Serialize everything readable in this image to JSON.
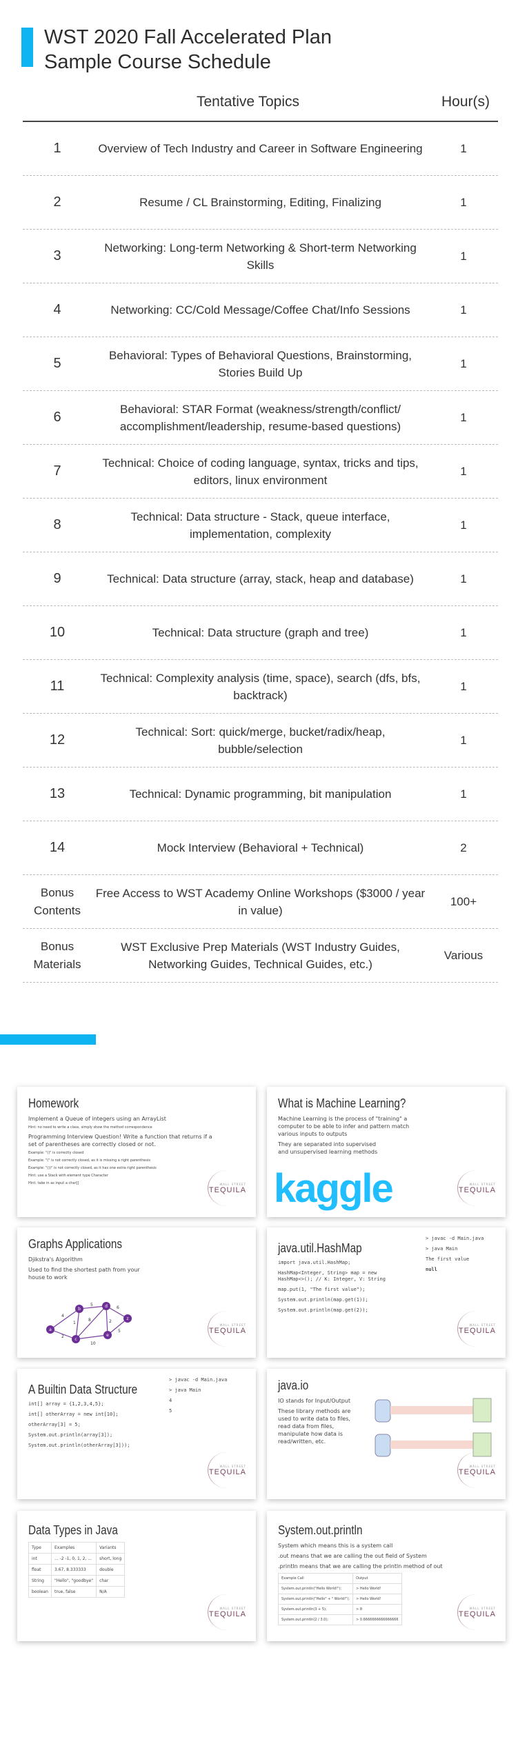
{
  "header": {
    "title_line1": "WST 2020 Fall Accelerated Plan",
    "title_line2": "Sample Course Schedule",
    "accent_color": "#0db4f0"
  },
  "table": {
    "col_topics": "Tentative Topics",
    "col_hours": "Hour(s)",
    "rows": [
      {
        "num": "1",
        "topic": "Overview of Tech Industry and Career in Software Engineering",
        "hours": "1"
      },
      {
        "num": "2",
        "topic": "Resume / CL Brainstorming, Editing, Finalizing",
        "hours": "1"
      },
      {
        "num": "3",
        "topic": "Networking: Long-term Networking & Short-term Networking Skills",
        "hours": "1"
      },
      {
        "num": "4",
        "topic": "Networking: CC/Cold Message/Coffee Chat/Info Sessions",
        "hours": "1"
      },
      {
        "num": "5",
        "topic": "Behavioral: Types of Behavioral Questions, Brainstorming, Stories Build Up",
        "hours": "1"
      },
      {
        "num": "6",
        "topic": "Behavioral: STAR Format (weakness/strength/conflict/ accomplishment/leadership, resume-based questions)",
        "hours": "1"
      },
      {
        "num": "7",
        "topic": "Technical: Choice of coding language, syntax, tricks and tips, editors, linux environment",
        "hours": "1"
      },
      {
        "num": "8",
        "topic": "Technical: Data structure - Stack, queue interface, implementation, complexity",
        "hours": "1"
      },
      {
        "num": "9",
        "topic": "Technical: Data structure (array, stack, heap and database)",
        "hours": "1"
      },
      {
        "num": "10",
        "topic": "Technical: Data structure (graph and tree)",
        "hours": "1"
      },
      {
        "num": "11",
        "topic": "Technical: Complexity analysis (time, space), search (dfs, bfs, backtrack)",
        "hours": "1"
      },
      {
        "num": "12",
        "topic": "Technical: Sort: quick/merge, bucket/radix/heap, bubble/selection",
        "hours": "1"
      },
      {
        "num": "13",
        "topic": "Technical: Dynamic programming, bit manipulation",
        "hours": "1"
      },
      {
        "num": "14",
        "topic": "Mock Interview (Behavioral + Technical)",
        "hours": "2"
      },
      {
        "num": "Bonus Contents",
        "topic": "Free Access to WST Academy Online Workshops ($3000 / year in value)",
        "hours": "100+"
      },
      {
        "num": "Bonus Materials",
        "topic": "WST Exclusive Prep Materials (WST Industry Guides, Networking Guides, Technical Guides, etc.)",
        "hours": "Various"
      }
    ]
  },
  "slides": {
    "logo_top": "WALL STREET",
    "logo_bottom": "TEQUILA",
    "homework": {
      "title": "Homework",
      "l1": "Implement a Queue of integers using an ArrayList",
      "l2": "Hint: no need to write a class, simply show the method correspondence",
      "l3": "Programming Interview Question! Write a function that returns if a set of parentheses are correctly closed or not.",
      "l4": "Example: \"()\" is correctly closed",
      "l5": "Example: \"(\" is not correctly closed, as it is missing a right parenthesis",
      "l6": "Example: \"())\" is not correctly closed, as it has one extra right parenthesis",
      "l7": "Hint: use a Stack with element type Character",
      "l8": "Hint: take in as input a char[]"
    },
    "ml": {
      "title": "What is Machine Learning?",
      "p1": "Machine Learning is the process of \"training\" a computer to be able to infer and pattern match various inputs to outputs",
      "p2": "They are separated into supervised and unsupervised learning methods",
      "kaggle": "kaggle"
    },
    "graphs": {
      "title": "Graphs Applications",
      "p1": "Djikstra's Algorithm",
      "p2": "Used to find the shortest path from your house to work"
    },
    "hashmap": {
      "title": "java.util.HashMap",
      "c1": "import java.util.HashMap;",
      "c2": "HashMap<Integer, String> map = new HashMap<>(); // K: Integer, V: String",
      "c3": "map.put(1, \"The first value\");",
      "c4": "System.out.println(map.get(1));",
      "c5": "System.out.println(map.get(2));",
      "o1": "> javac -d Main.java",
      "o2": "> java Main",
      "o3": "The first value",
      "o4": "null"
    },
    "builtin": {
      "title": "A Builtin Data Structure",
      "c1": "int[] array = {1,2,3,4,5};",
      "c2": "int[] otherArray = new int[10];",
      "c3": "otherArray[3] = 5;",
      "c4": "System.out.println(array[3]);",
      "c5": "System.out.println(otherArray[3]));",
      "o1": "> javac -d Main.java",
      "o2": "> java Main",
      "o3": "4",
      "o4": "5"
    },
    "javaio": {
      "title": "java.io",
      "p1": "IO stands for Input/Output",
      "p2": "These library methods are used to write data to files, read data from files, manipulate how data is read/written, etc."
    },
    "datatypes": {
      "title": "Data Types in Java",
      "head": [
        "Type",
        "Examples",
        "Variants"
      ],
      "rows": [
        [
          "int",
          "... -2 -1, 0, 1, 2, ...",
          "short, long"
        ],
        [
          "float",
          "3.67, 8.333333",
          "double"
        ],
        [
          "String",
          "\"Hello\", \"goodbye\"",
          "char"
        ],
        [
          "boolean",
          "true, false",
          "N/A"
        ]
      ]
    },
    "println": {
      "title": "System.out.println",
      "p1": "System which means this is a system call",
      ".p2": "",
      "p2": ".out means that we are calling the out field of System",
      "p3": ".println means that we are calling the println method of out",
      "head": [
        "Example Call",
        "Output"
      ],
      "rows": [
        [
          "System.out.println(\"Hello World!\");",
          "> Hello World!"
        ],
        [
          "System.out.println(\"Hello\" + \" World!\");",
          "> Hello World!"
        ],
        [
          "System.out.println(3 + 5);",
          "> 8"
        ],
        [
          "System.out.println(2 / 3.0);",
          "> 0.6666666666666666"
        ]
      ]
    }
  }
}
